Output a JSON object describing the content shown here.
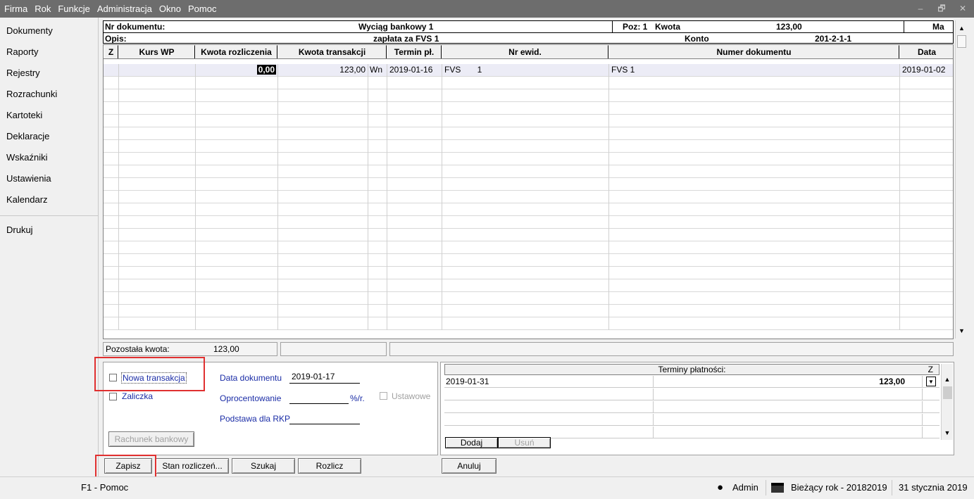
{
  "menu": [
    "Firma",
    "Rok",
    "Funkcje",
    "Administracja",
    "Okno",
    "Pomoc"
  ],
  "window_controls": {
    "minimize": "–",
    "restore": "🗗",
    "close": "✕"
  },
  "sidebar": {
    "items": [
      {
        "label": "Dokumenty"
      },
      {
        "label": "Raporty"
      },
      {
        "label": "Rejestry"
      },
      {
        "label": "Rozrachunki"
      },
      {
        "label": "Kartoteki"
      },
      {
        "label": "Deklaracje"
      },
      {
        "label": "Wskaźniki"
      },
      {
        "label": "Ustawienia"
      },
      {
        "label": "Kalendarz"
      },
      {
        "label": "Drukuj"
      }
    ]
  },
  "header": {
    "nr_dok_label": "Nr dokumentu:",
    "nr_dok_value": "Wyciąg bankowy 1",
    "poz_label": "Poz: 1",
    "kwota_label": "Kwota",
    "kwota_value": "123,00",
    "ma_label": "Ma",
    "opis_label": "Opis:",
    "opis_value": "zapłata za FVS 1",
    "konto_label": "Konto",
    "konto_value": "201-2-1-1"
  },
  "grid": {
    "columns": [
      "Z",
      "Kurs WP",
      "Kwota rozliczenia",
      "Kwota transakcji",
      "Termin pł.",
      "Nr ewid.",
      "Numer dokumentu",
      "Data"
    ],
    "rows": [
      {
        "z": "",
        "kurs": "",
        "kwota_rozl": "0,00",
        "kwota_trans": "123,00",
        "wn": "Wn",
        "termin": "2019-01-16",
        "nr_ewid": "FVS       1",
        "numer_dok": "FVS 1",
        "data": "2019-01-02"
      }
    ]
  },
  "remaining": {
    "label": "Pozostała kwota:",
    "value": "123,00"
  },
  "form": {
    "nowa_transakcja": "Nowa transakcja",
    "zaliczka": "Zaliczka",
    "data_dok_label": "Data dokumentu",
    "data_dok_value": "2019-01-17",
    "oprocentowanie_label": "Oprocentowanie",
    "oprocentowanie_unit": "%/r.",
    "ustawowe": "Ustawowe",
    "podstawa_label": "Podstawa dla RKP",
    "rachunek_button": "Rachunek bankowy"
  },
  "terms": {
    "title": "Terminy płatności:",
    "z_label": "Z",
    "rows": [
      {
        "date": "2019-01-31",
        "amount": "123,00"
      }
    ],
    "dodaj": "Dodaj",
    "usun": "Usuń"
  },
  "buttons": {
    "zapisz": "Zapisz",
    "stan": "Stan rozliczeń...",
    "szukaj": "Szukaj",
    "rozlicz": "Rozlicz",
    "anuluj": "Anuluj"
  },
  "status": {
    "help": "F1 - Pomoc",
    "user": "Admin",
    "year": "Bieżący rok - 20182019",
    "date": "31 stycznia 2019"
  },
  "colors": {
    "menubar": "#6d6d6d",
    "highlight": "#e03030",
    "link_blue": "#1a2ca6"
  }
}
